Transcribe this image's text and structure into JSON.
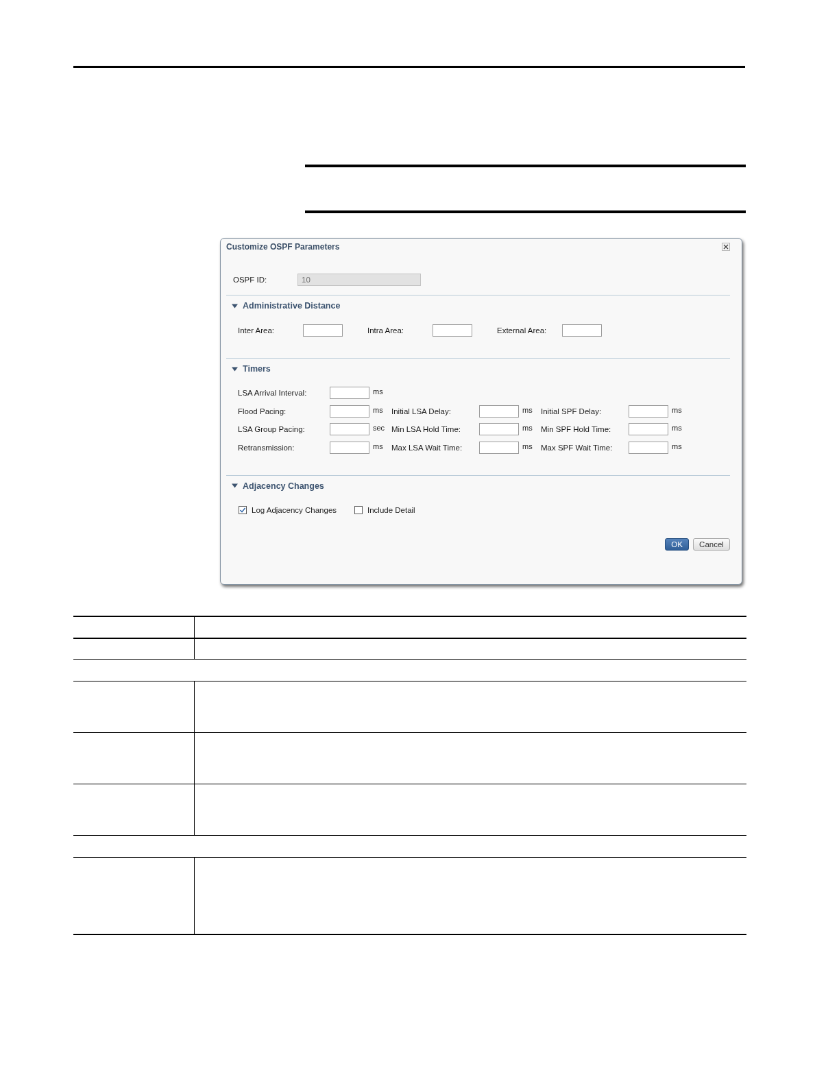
{
  "dialog": {
    "title": "Customize OSPF Parameters",
    "ospf_id": {
      "label": "OSPF ID:",
      "value": "10",
      "disabled": true
    },
    "sections": [
      {
        "title": "Administrative Distance",
        "expanded": true,
        "kind": "inline_fields",
        "fields": [
          {
            "label": "Inter Area:"
          },
          {
            "label": "Intra Area:"
          },
          {
            "label": "External Area:"
          }
        ]
      },
      {
        "title": "Timers",
        "expanded": true,
        "kind": "field_grid",
        "rows": [
          {
            "cells": [
              {
                "label": "LSA Arrival Interval:",
                "unit": "ms"
              }
            ]
          },
          {
            "cells": [
              {
                "label": "Flood Pacing:",
                "unit": "ms"
              },
              {
                "label": "Initial LSA Delay:",
                "unit": "ms"
              },
              {
                "label": "Initial SPF Delay:",
                "unit": "ms"
              }
            ]
          },
          {
            "cells": [
              {
                "label": "LSA Group Pacing:",
                "unit": "sec"
              },
              {
                "label": "Min LSA Hold Time:",
                "unit": "ms"
              },
              {
                "label": "Min SPF Hold Time:",
                "unit": "ms"
              }
            ]
          },
          {
            "cells": [
              {
                "label": "Retransmission:",
                "unit": "ms"
              },
              {
                "label": "Max LSA Wait Time:",
                "unit": "ms"
              },
              {
                "label": "Max SPF Wait Time:",
                "unit": "ms"
              }
            ]
          }
        ]
      },
      {
        "title": "Adjacency Changes",
        "expanded": true,
        "kind": "checkboxes",
        "options": [
          {
            "label": "Log Adjacency Changes",
            "checked": true
          },
          {
            "label": "Include Detail",
            "checked": false
          }
        ]
      }
    ],
    "buttons": [
      {
        "label": "OK",
        "kind": "primary"
      },
      {
        "label": "Cancel",
        "kind": "secondary"
      }
    ]
  }
}
